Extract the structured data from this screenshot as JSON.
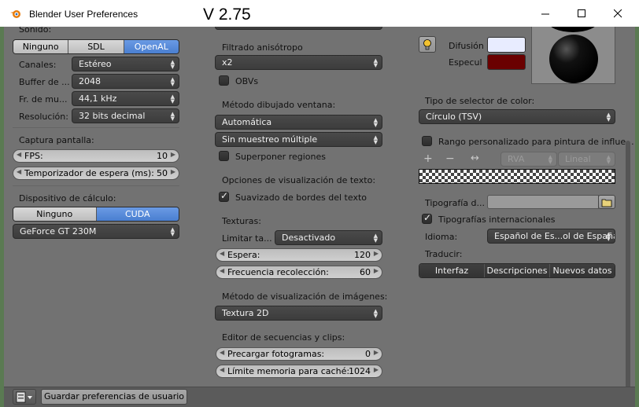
{
  "window": {
    "title": "Blender User Preferences",
    "version": "V 2.75"
  },
  "system": {
    "sound": {
      "label": "Sonido:",
      "backends": [
        "Ninguno",
        "SDL",
        "OpenAL"
      ],
      "active_backend": "OpenAL",
      "channels": {
        "label": "Canales:",
        "value": "Estéreo"
      },
      "buffer": {
        "label": "Buffer de ...",
        "value": "2048"
      },
      "sample_rate": {
        "label": "Fr. de mu...",
        "value": "44,1 kHz"
      },
      "resolution": {
        "label": "Resolución:",
        "value": "32 bits decimal"
      }
    },
    "screencast": {
      "label": "Captura pantalla:",
      "fps": {
        "label": "FPS:",
        "value": 10
      },
      "wait_timer": {
        "label": "Temporizador de espera (ms):",
        "value": 50
      }
    },
    "compute_device": {
      "label": "Dispositivo de cálculo:",
      "options": [
        "Ninguno",
        "CUDA"
      ],
      "active": "CUDA",
      "device": "GeForce GT 230M"
    }
  },
  "opengl": {
    "anisotropic": {
      "label": "Filtrado anisótropo",
      "value": "x2"
    },
    "vbos": {
      "label": "OBVs",
      "checked": false
    },
    "window_draw": {
      "label": "Método dibujado ventana:",
      "method": "Automática",
      "multisample": "Sin muestreo múltiple",
      "region_overlap": {
        "label": "Superponer regiones",
        "checked": false
      }
    },
    "text_antialias": {
      "label": "Opciones de visualización de texto:",
      "antialias": {
        "label": "Suavizado de bordes del texto",
        "checked": true
      }
    },
    "textures": {
      "label": "Texturas:",
      "limit": {
        "label": "Limitar ta...",
        "value": "Desactivado"
      },
      "timeout": {
        "label": "Espera:",
        "value": 120
      },
      "gc_rate": {
        "label": "Frecuencia recolección:",
        "value": 60
      }
    },
    "image_draw": {
      "label": "Método de visualización de imágenes:",
      "value": "Textura 2D"
    },
    "sequencer": {
      "label": "Editor de secuencias y clips:",
      "prefetch": {
        "label": "Precargar fotogramas:",
        "value": 0
      },
      "cache_limit": {
        "label": "Límite memoria para caché:",
        "value": 1024
      }
    }
  },
  "right": {
    "light": {
      "diffuse_label": "Difusión",
      "diffuse_color": "#e8ecff",
      "specular_label": "Especul",
      "specular_color": "#6a0000"
    },
    "color_picker": {
      "label": "Tipo de selector de color:",
      "value": "Círculo (TSV)"
    },
    "custom_range": {
      "label": "Rango personalizado para pintura de influe...",
      "checked": false
    },
    "ramp": {
      "add": "+",
      "remove": "−",
      "flip": "↔",
      "color_mode": "RVA",
      "interpolation": "Lineal"
    },
    "font": {
      "label": "Tipografía d...",
      "value": ""
    },
    "international": {
      "label": "Tipografías internacionales",
      "checked": true
    },
    "language": {
      "label": "Idioma:",
      "value": "Español de Es...ol de España)"
    },
    "translate": {
      "label": "Traducir:",
      "options": [
        "Interfaz",
        "Descripciones",
        "Nuevos datos"
      ]
    }
  },
  "bottom": {
    "save_label": "Guardar preferencias de usuario"
  }
}
